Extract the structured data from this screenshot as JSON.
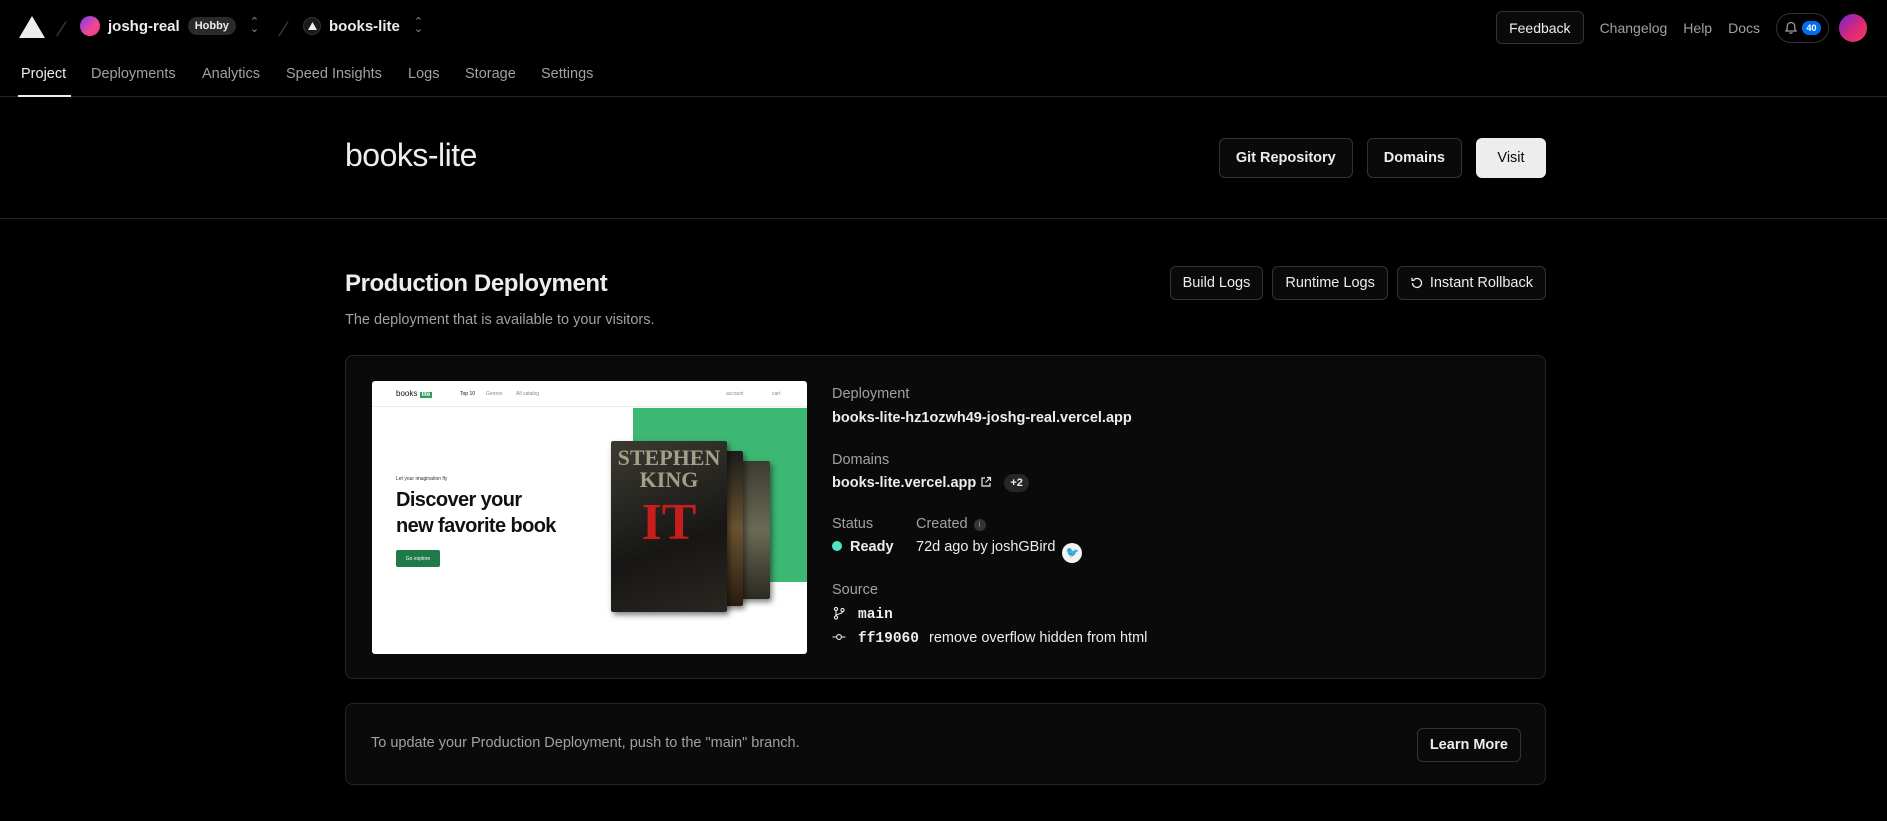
{
  "topbar": {
    "team_name": "joshg-real",
    "plan_badge": "Hobby",
    "project_name": "books-lite",
    "feedback_label": "Feedback",
    "links": [
      "Changelog",
      "Help",
      "Docs"
    ],
    "notification_count": "40"
  },
  "tabs": [
    {
      "label": "Project",
      "active": true
    },
    {
      "label": "Deployments"
    },
    {
      "label": "Analytics"
    },
    {
      "label": "Speed Insights"
    },
    {
      "label": "Logs"
    },
    {
      "label": "Storage"
    },
    {
      "label": "Settings"
    }
  ],
  "header": {
    "title": "books-lite",
    "git_repository_label": "Git Repository",
    "domains_label": "Domains",
    "visit_label": "Visit"
  },
  "production": {
    "title": "Production Deployment",
    "subtitle": "The deployment that is available to your visitors.",
    "build_logs_label": "Build Logs",
    "runtime_logs_label": "Runtime Logs",
    "rollback_label": "Instant Rollback",
    "deployment_label": "Deployment",
    "deployment_url": "books-lite-hz1ozwh49-joshg-real.vercel.app",
    "domains_label": "Domains",
    "domain": "books-lite.vercel.app",
    "domain_extra": "+2",
    "status_label": "Status",
    "status_value": "Ready",
    "created_label": "Created",
    "created_value": "72d ago by joshGBird",
    "source_label": "Source",
    "branch": "main",
    "commit_hash": "ff19060",
    "commit_message": "remove overflow hidden from html",
    "status_color": "#50e3c2"
  },
  "preview": {
    "logo": "books",
    "logo_badge": "lite",
    "nav_links": [
      "Top 10",
      "Genres",
      "All catalog"
    ],
    "nav_right": [
      "account",
      "cart"
    ],
    "tagline": "Let your imagination fly",
    "headline_1": "Discover your",
    "headline_2": "new favorite book",
    "cta": "Go explore",
    "book_author_1": "STEPHEN",
    "book_author_2": "KING",
    "book_title": "IT"
  },
  "note": {
    "text": "To update your Production Deployment, push to the \"main\" branch.",
    "learn_more_label": "Learn More"
  }
}
